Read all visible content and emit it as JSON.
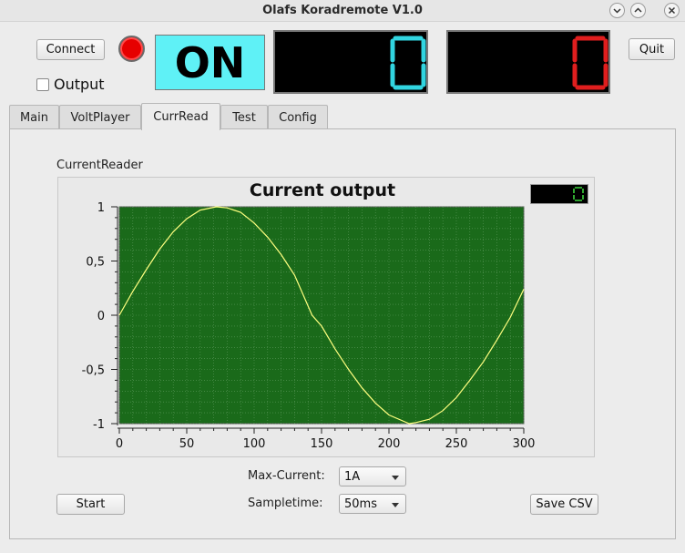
{
  "window": {
    "title": "Olafs Koradremote V1.0"
  },
  "toolbar": {
    "connect_label": "Connect",
    "quit_label": "Quit",
    "output_label": "Output",
    "output_checked": false,
    "status_text": "ON",
    "voltage_display": "0",
    "current_display": "0",
    "led_color": "#e60000"
  },
  "tabs": [
    {
      "label": "Main"
    },
    {
      "label": "VoltPlayer"
    },
    {
      "label": "CurrRead",
      "active": true
    },
    {
      "label": "Test"
    },
    {
      "label": "Config"
    }
  ],
  "currread": {
    "group_label": "CurrentReader",
    "readout": "0",
    "max_current_label": "Max-Current:",
    "max_current_value": "1A",
    "sampletime_label": "Sampletime:",
    "sampletime_value": "50ms",
    "start_label": "Start",
    "save_csv_label": "Save CSV"
  },
  "chart_data": {
    "type": "line",
    "title": "Current output",
    "xlabel": "",
    "ylabel": "",
    "xlim": [
      0,
      300
    ],
    "ylim": [
      -1,
      1
    ],
    "x_ticks": [
      "0",
      "50",
      "100",
      "150",
      "200",
      "250",
      "300"
    ],
    "y_ticks": [
      "1",
      "0,5",
      "0",
      "-0,5",
      "-1"
    ],
    "grid": true,
    "background_color": "#1a6a1a",
    "line_color": "#ffff80",
    "series": [
      {
        "x": [
          0,
          10,
          20,
          30,
          40,
          50,
          60,
          72,
          80,
          90,
          100,
          110,
          120,
          130,
          143,
          150,
          160,
          170,
          180,
          190,
          200,
          215,
          220,
          230,
          240,
          250,
          260,
          270,
          280,
          290,
          300
        ],
        "y": [
          0,
          0.22,
          0.42,
          0.61,
          0.77,
          0.89,
          0.97,
          1.0,
          0.99,
          0.95,
          0.85,
          0.72,
          0.56,
          0.37,
          0.0,
          -0.1,
          -0.31,
          -0.5,
          -0.67,
          -0.81,
          -0.92,
          -1.0,
          -0.99,
          -0.96,
          -0.88,
          -0.76,
          -0.6,
          -0.43,
          -0.23,
          -0.02,
          0.24
        ]
      }
    ]
  }
}
